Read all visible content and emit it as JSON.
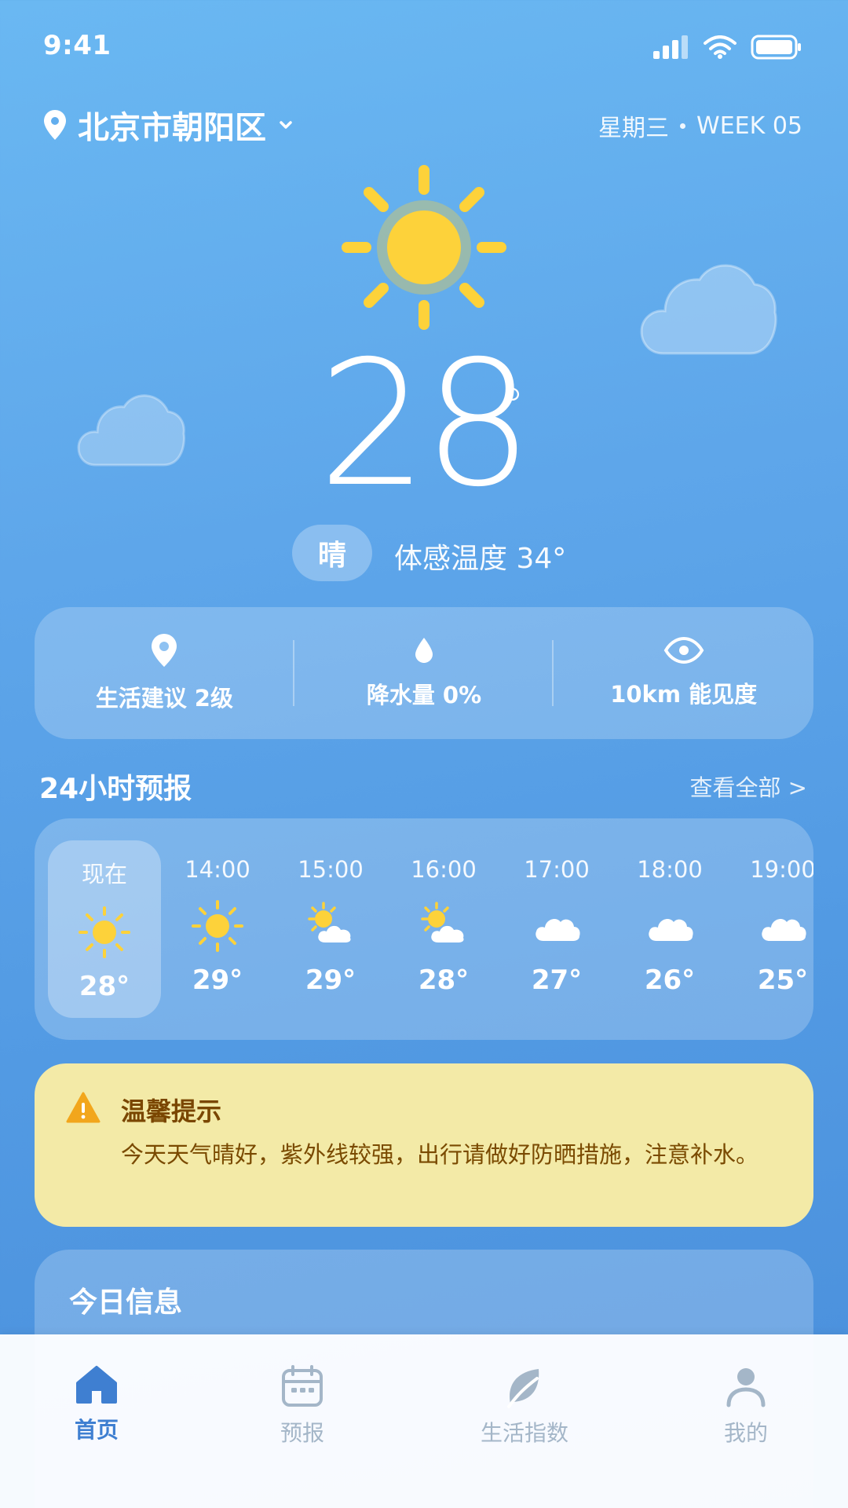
{
  "status_bar": {
    "time": "9:41",
    "icons": [
      "cellular-signal-icon",
      "wifi-icon",
      "battery-icon"
    ]
  },
  "location": {
    "name": "北京市朝阳区",
    "icon": "location-pin-icon",
    "dropdown_icon": "chevron-down-icon"
  },
  "date": {
    "weekday": "星期三",
    "week": "WEEK 05"
  },
  "current": {
    "temperature": "28",
    "degree_symbol": "°",
    "condition": "晴",
    "feels_like": "体感温度 34°",
    "icon": "sun-icon"
  },
  "stats": [
    {
      "icon": "location-pin-icon",
      "label": "生活建议 2级"
    },
    {
      "icon": "water-drop-icon",
      "label": "降水量 0%"
    },
    {
      "icon": "eye-icon",
      "label": "10km 能见度"
    }
  ],
  "hourly": {
    "title": "24小时预报",
    "view_all": "查看全部 >",
    "items": [
      {
        "time": "现在",
        "icon": "sun-icon",
        "temp": "28°",
        "active": true
      },
      {
        "time": "14:00",
        "icon": "sun-icon",
        "temp": "29°"
      },
      {
        "time": "15:00",
        "icon": "partly-sunny-icon",
        "temp": "29°"
      },
      {
        "time": "16:00",
        "icon": "partly-sunny-icon",
        "temp": "28°"
      },
      {
        "time": "17:00",
        "icon": "cloud-icon",
        "temp": "27°"
      },
      {
        "time": "18:00",
        "icon": "cloud-icon",
        "temp": "26°"
      },
      {
        "time": "19:00",
        "icon": "cloud-icon",
        "temp": "25°"
      }
    ]
  },
  "tip": {
    "icon": "warning-icon",
    "title": "温馨提示",
    "text": "今天天气晴好，紫外线较强，出行请做好防晒措施，注意补水。"
  },
  "today": {
    "title": "今日信息"
  },
  "nav": [
    {
      "label": "首页",
      "icon": "home-icon",
      "active": true
    },
    {
      "label": "预报",
      "icon": "calendar-icon"
    },
    {
      "label": "生活指数",
      "icon": "leaf-icon"
    },
    {
      "label": "我的",
      "icon": "user-icon"
    }
  ],
  "colors": {
    "accent": "#3f7fd1",
    "sun": "#fdd23a",
    "tip_bg": "#f3eaa7",
    "tip_text": "#7a4a00",
    "nav_inactive": "#a4b6c8"
  }
}
